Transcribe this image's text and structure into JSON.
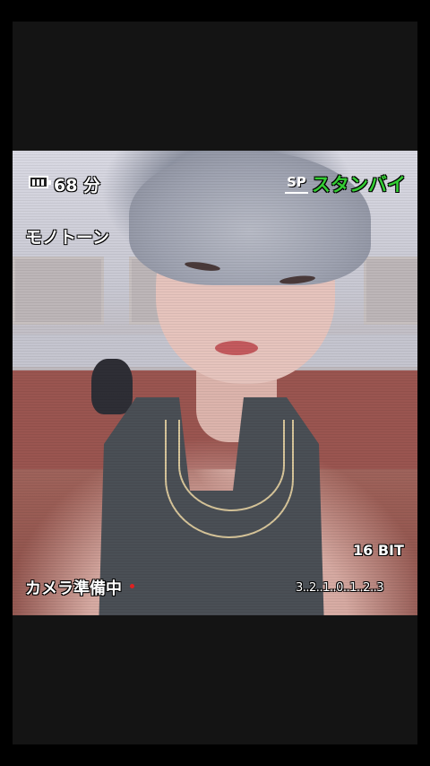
{
  "osd": {
    "battery_time": "68 分",
    "mode": "モノトーン",
    "recording_mode": "SP",
    "status": "スタンバイ",
    "status_color": "#33cc33",
    "bit_depth": "16 BIT",
    "camera_status": "カメラ準備中",
    "counter": "3..2..1..0..1..2..3",
    "rec_dot_color": "#e02020"
  },
  "icons": [
    "battery-icon",
    "rec-dot-icon"
  ]
}
